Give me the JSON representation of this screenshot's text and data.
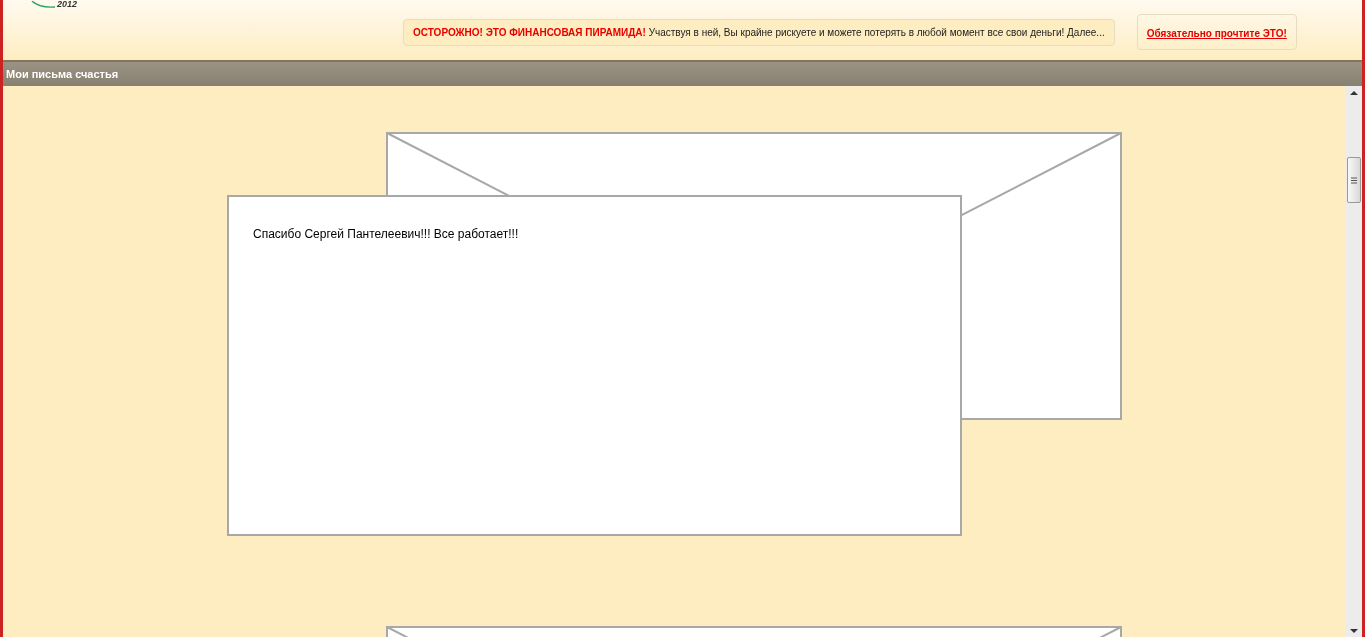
{
  "logo": {
    "year": "2012"
  },
  "warning": {
    "text": "**ОСТОРОЖНО! ЭТО ФИНАНСОВАЯ ПИРАМИДА!** Участвуя в ней, Вы крайне рискуете и можете потерять в любой момент все свои деньги! Далее..."
  },
  "notice_link": "Обязательно прочтите ЭТО!",
  "section": {
    "title": "Мои письма счастья"
  },
  "letters": [
    {
      "message": "Спасибо Сергей Пантелеевич!!! Все работает!!!"
    }
  ]
}
